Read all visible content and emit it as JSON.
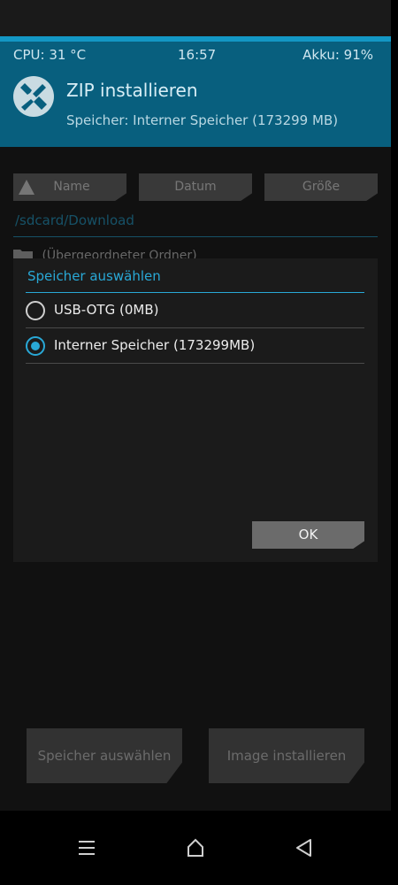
{
  "status": {
    "cpu": "CPU: 31 °C",
    "time": "16:57",
    "battery": "Akku: 91%"
  },
  "header": {
    "title": "ZIP installieren",
    "subtitle": "Speicher: Interner Speicher (173299 MB)"
  },
  "browser": {
    "sort_buttons": [
      "Name",
      "Datum",
      "Größe"
    ],
    "path": "/sdcard/Download",
    "parent_folder": "(Übergeordneter Ordner)",
    "select_storage_label": "Speicher auswählen",
    "install_image_label": "Image installieren"
  },
  "dialog": {
    "title": "Speicher auswählen",
    "options": [
      {
        "label": "USB-OTG (0MB)",
        "selected": false
      },
      {
        "label": "Interner Speicher (173299MB)",
        "selected": true
      }
    ],
    "ok_label": "OK"
  },
  "colors": {
    "accent": "#29a8d6",
    "header_bg": "#085f7e",
    "button_bg": "#6b6b6b"
  },
  "navbar": {
    "icons": [
      "menu-icon",
      "home-icon",
      "back-icon"
    ]
  }
}
